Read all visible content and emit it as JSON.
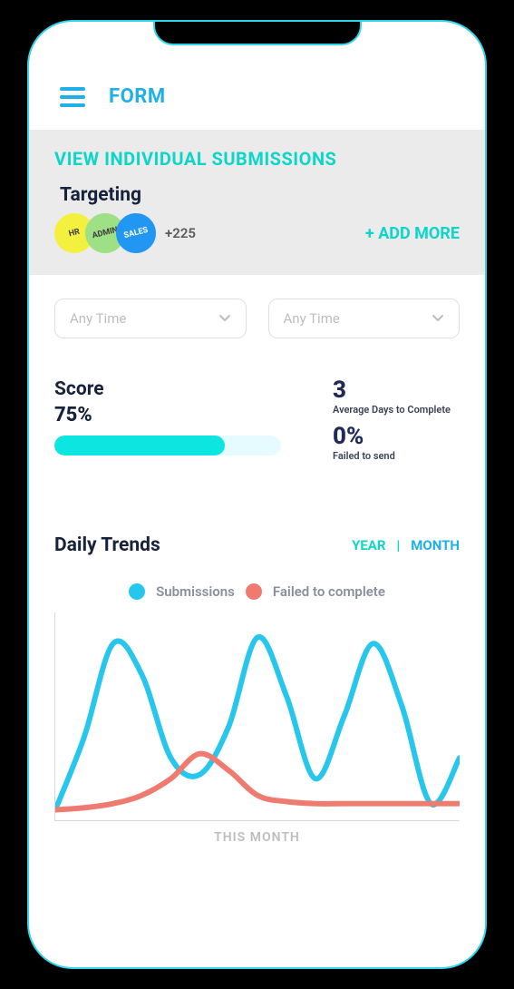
{
  "header": {
    "title": "FORM"
  },
  "panel": {
    "title": "VIEW INDIVIDUAL SUBMISSIONS",
    "targeting_label": "Targeting",
    "chips": [
      "HR",
      "ADMIN",
      "SALES"
    ],
    "chip_overflow": "+225",
    "add_more": "+ ADD MORE"
  },
  "filters": {
    "left_placeholder": "Any Time",
    "right_placeholder": "Any Time"
  },
  "score": {
    "title": "Score",
    "value_text": "75%",
    "progress_pct": 75,
    "avg_days_value": "3",
    "avg_days_label": "Average Days to Complete",
    "failed_value": "0%",
    "failed_label": "Failed to send"
  },
  "trends": {
    "title": "Daily Trends",
    "range": {
      "year": "YEAR",
      "sep": "|",
      "month": "MONTH"
    },
    "legend": {
      "submissions": "Submissions",
      "failed": "Failed to complete"
    },
    "xlabel": "THIS MONTH"
  },
  "colors": {
    "accent_cyan": "#0dd6c9",
    "accent_blue": "#1fb0e6",
    "series_blue": "#27c6ed",
    "series_red": "#ef7a6f"
  },
  "chart_data": {
    "type": "line",
    "xlabel": "THIS MONTH",
    "ylabel": "",
    "ylim": [
      0,
      100
    ],
    "x": [
      0,
      1,
      2,
      3,
      4,
      5,
      6,
      7,
      8,
      9,
      10,
      11,
      12,
      13,
      14
    ],
    "series": [
      {
        "name": "Submissions",
        "color": "#27c6ed",
        "values": [
          5,
          40,
          85,
          70,
          30,
          22,
          45,
          88,
          60,
          20,
          50,
          85,
          55,
          8,
          30
        ]
      },
      {
        "name": "Failed to complete",
        "color": "#ef7a6f",
        "values": [
          5,
          6,
          8,
          12,
          20,
          32,
          24,
          12,
          9,
          8,
          8,
          8,
          8,
          8,
          8
        ]
      }
    ]
  }
}
